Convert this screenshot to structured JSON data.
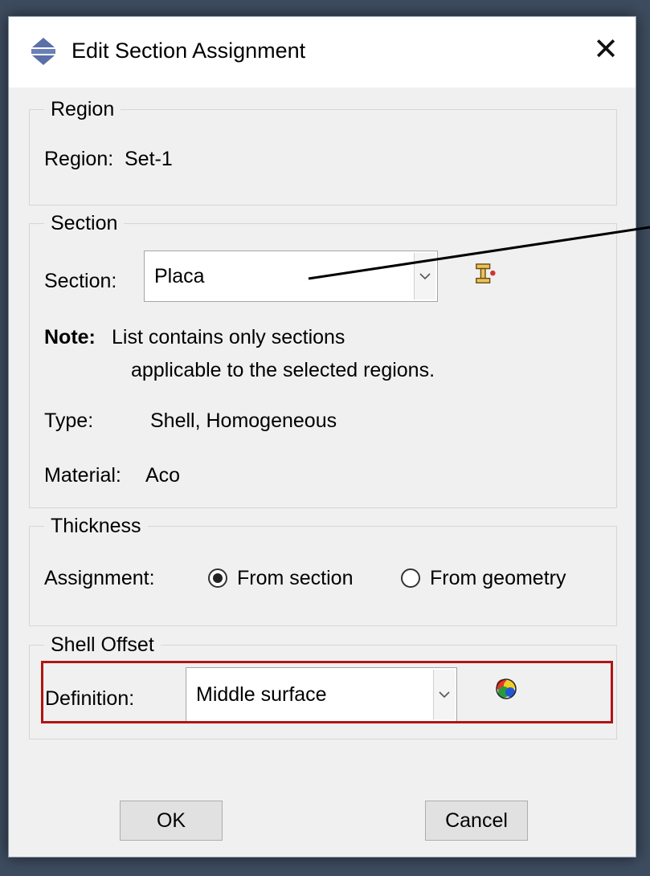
{
  "window": {
    "title": "Edit Section Assignment",
    "close_glyph": "✕"
  },
  "region": {
    "group_label": "Region",
    "label": "Region:",
    "value": "Set-1"
  },
  "section": {
    "group_label": "Section",
    "label": "Section:",
    "selected": "Placa",
    "note_label": "Note:",
    "note_line1": "List contains only sections",
    "note_line2": "applicable to the selected regions.",
    "type_label": "Type:",
    "type_value": "Shell, Homogeneous",
    "material_label": "Material:",
    "material_value": "Aco"
  },
  "thickness": {
    "group_label": "Thickness",
    "assignment_label": "Assignment:",
    "options": [
      {
        "label": "From section",
        "checked": true
      },
      {
        "label": "From geometry",
        "checked": false
      }
    ]
  },
  "shell_offset": {
    "group_label": "Shell Offset",
    "definition_label": "Definition:",
    "selected": "Middle surface"
  },
  "buttons": {
    "ok": "OK",
    "cancel": "Cancel"
  },
  "colors": {
    "highlight": "#b01515",
    "background": "#3d4c5f"
  }
}
